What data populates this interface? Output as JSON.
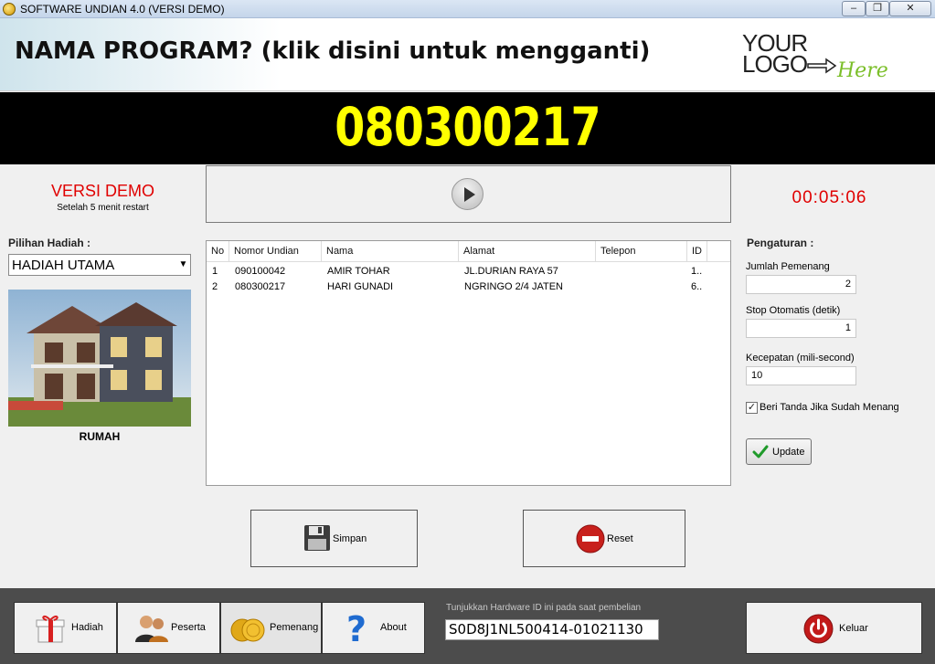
{
  "window": {
    "title": "SOFTWARE UNDIAN 4.0 (VERSI DEMO)",
    "min": "–",
    "max": "❐",
    "close": "✕"
  },
  "header": {
    "program_name": "NAMA PROGRAM? (klik disini untuk mengganti)",
    "logo_line1": "YOUR",
    "logo_line2": "LOGO",
    "logo_script": "Here"
  },
  "draw": {
    "current_number": "080300217",
    "timer": "00:05:06"
  },
  "demo": {
    "label": "VERSI DEMO",
    "sublabel": "Setelah 5 menit restart"
  },
  "prize": {
    "label": "Pilihan Hadiah :",
    "selected": "HADIAH UTAMA",
    "name": "RUMAH"
  },
  "table": {
    "columns": [
      "No",
      "Nomor Undian",
      "Nama",
      "Alamat",
      "Telepon",
      "ID"
    ],
    "rows": [
      [
        "1",
        "090100042",
        "AMIR TOHAR",
        "JL.DURIAN RAYA 57",
        "",
        "1.."
      ],
      [
        "2",
        "080300217",
        "HARI GUNADI",
        "NGRINGO 2/4 JATEN",
        "",
        "6.."
      ]
    ]
  },
  "settings": {
    "title": "Pengaturan :",
    "jumlah_label": "Jumlah Pemenang",
    "jumlah_value": "2",
    "stop_label": "Stop Otomatis (detik)",
    "stop_value": "1",
    "kecepatan_label": "Kecepatan (mili-second)",
    "kecepatan_value": "10",
    "tandai_label": "Beri Tanda Jika Sudah Menang",
    "tandai_checked": true,
    "update_label": "Update"
  },
  "actions": {
    "simpan": "Simpan",
    "reset": "Reset"
  },
  "footer": {
    "hadiah": "Hadiah",
    "peserta": "Peserta",
    "pemenang": "Pemenang",
    "about": "About",
    "hwid_label": "Tunjukkan Hardware ID ini pada saat pembelian",
    "hwid_value": "S0D8J1NL500414-01021130",
    "keluar": "Keluar"
  },
  "colors": {
    "number_yellow": "#ffff00",
    "demo_red": "#e00000",
    "footer_bg": "#4c4c4c"
  }
}
